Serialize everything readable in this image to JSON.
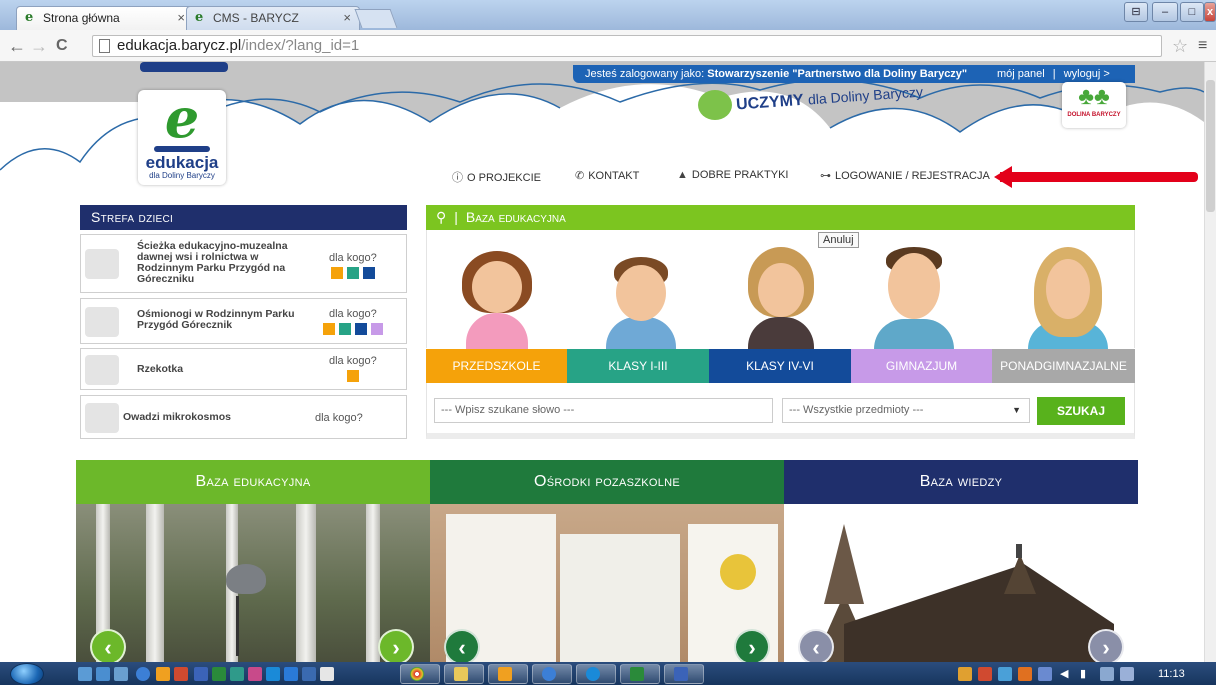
{
  "browser": {
    "tabs": [
      {
        "title": "Strona główna",
        "active": true
      },
      {
        "title": "CMS - BARYCZ",
        "active": false
      }
    ],
    "close_glyph": "×",
    "url_host": "edukacja.barycz.pl",
    "url_path": "/index/?lang_id=1",
    "nav": {
      "back": "←",
      "forward": "→",
      "reload": "C"
    },
    "star": "☆",
    "menu": "≡",
    "win_min": "–",
    "win_max": "□",
    "win_close": "x",
    "win_restore": "⊟"
  },
  "header": {
    "logged_prefix": "Jesteś zalogowany jako:",
    "logged_user": "Stowarzyszenie \"Partnerstwo dla Doliny Baryczy\"",
    "panel_link": "mój panel",
    "sep": "|",
    "logout_link": "wyloguj >",
    "logo_text": "edukacja",
    "logo_sub": "dla Doliny Baryczy",
    "slogan_bold": "UCZYMY",
    "slogan_rest": "dla Doliny Baryczy",
    "partner_label": "DOLINA BARYCZY",
    "nav": [
      {
        "label": "O PROJEKCIE",
        "icon": "info-icon"
      },
      {
        "label": "KONTAKT",
        "icon": "phone-icon"
      },
      {
        "label": "DOBRE PRAKTYKI",
        "icon": "thumbs-up-icon"
      },
      {
        "label": "LOGOWANIE / REJESTRACJA",
        "icon": "key-icon"
      }
    ]
  },
  "strefa": {
    "title": "Strefa dzieci",
    "items": [
      {
        "title": "Ścieżka edukacyjno-muzealna dawnej wsi i rolnictwa w Rodzinnym Parku Przygód na Góreczniku",
        "for": "dla kogo?",
        "colors": [
          "#f5a20a",
          "#27a386",
          "#134b9a"
        ]
      },
      {
        "title": "Ośmionogi w Rodzinnym Parku Przygód Górecznik",
        "for": "dla kogo?",
        "colors": [
          "#f5a20a",
          "#27a386",
          "#134b9a",
          "#c79ae8"
        ]
      },
      {
        "title": "Rzekotka",
        "for": "dla kogo?",
        "colors": [
          "#f5a20a"
        ]
      },
      {
        "title": "Owadzi mikrokosmos",
        "for": "dla kogo?",
        "colors": []
      }
    ]
  },
  "baza": {
    "title": "Baza edukacyjna",
    "tooltip": "Anuluj",
    "categories": [
      {
        "label": "PRZEDSZKOLE",
        "color": "#f5a20a"
      },
      {
        "label": "KLASY I-III",
        "color": "#27a386"
      },
      {
        "label": "KLASY IV-VI",
        "color": "#134b9a"
      },
      {
        "label": "GIMNAZJUM",
        "color": "#c79ae8"
      },
      {
        "label": "PONADGIMNAZJALNE",
        "color": "#a8a8a8"
      }
    ],
    "search_placeholder": "--- Wpisz szukane słowo ---",
    "select_value": "--- Wszystkie przedmioty ---",
    "search_button": "SZUKAJ"
  },
  "panels": [
    {
      "title": "Baza edukacyjna",
      "color": "#6cb82a"
    },
    {
      "title": "Ośrodki pozaszkolne",
      "color": "#1f7a3c"
    },
    {
      "title": "Baza wiedzy",
      "color": "#1f2f6c"
    }
  ],
  "taskbar": {
    "clock": "11:13"
  }
}
